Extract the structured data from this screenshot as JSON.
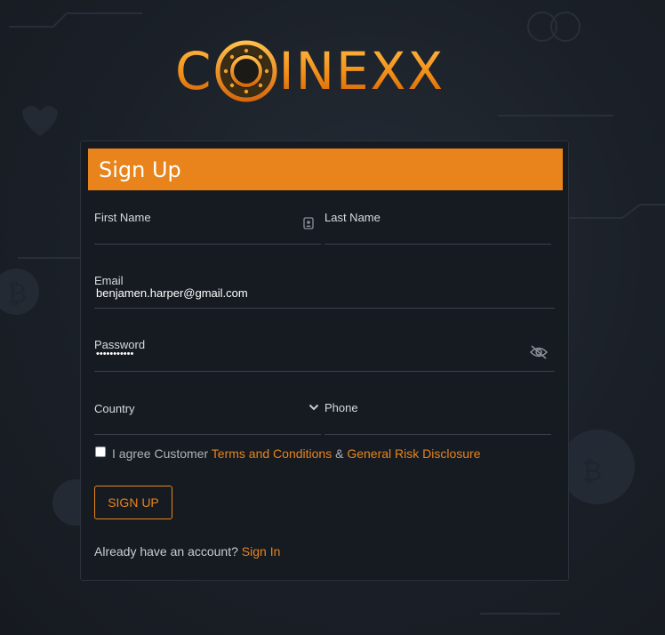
{
  "brand": {
    "logo_text_left": "C",
    "logo_text_right": "INEXX",
    "accent": "#e8841b"
  },
  "form": {
    "title": "Sign Up",
    "first_name": {
      "label": "First Name",
      "value": ""
    },
    "last_name": {
      "label": "Last Name",
      "value": ""
    },
    "email": {
      "label": "Email",
      "value": "benjamen.harper@gmail.com"
    },
    "password": {
      "label": "Password",
      "masked_value": "•••••••••••"
    },
    "country": {
      "label": "Country",
      "value": ""
    },
    "phone": {
      "label": "Phone",
      "value": ""
    },
    "agree": {
      "prefix": "I agree Customer ",
      "terms_link": "Terms and Conditions",
      "joiner": " & ",
      "risk_link": "General Risk Disclosure",
      "checked": false
    },
    "submit_label": "SIGN UP",
    "signin_prompt": "Already have an account? ",
    "signin_link": "Sign In"
  },
  "icons": {
    "contact_card": "contact-card-icon",
    "eye_off": "eye-off-icon",
    "chevron_down": "chevron-down-icon",
    "logo_ring": "coin-ring-icon"
  }
}
